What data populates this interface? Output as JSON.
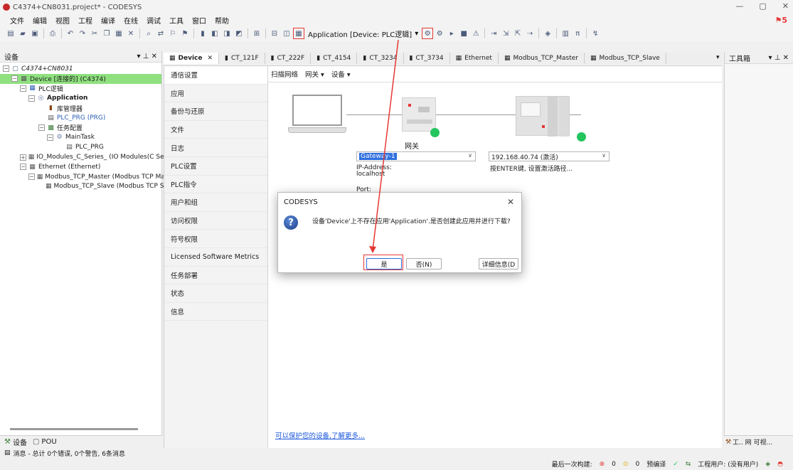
{
  "window": {
    "title": "C4374+CN8031.project* - CODESYS",
    "controls": [
      "—",
      "▢",
      "✕"
    ]
  },
  "menu": [
    "文件",
    "编辑",
    "视图",
    "工程",
    "编译",
    "在线",
    "调试",
    "工具",
    "窗口",
    "帮助"
  ],
  "notifications": {
    "count": "5"
  },
  "toolbar": {
    "active_application": "Application [Device: PLC逻辑]"
  },
  "left_pane": {
    "title": "设备",
    "header_controls": "▾ ⊥ ✕",
    "tree": [
      {
        "label": "C4374+CN8031",
        "italic": true
      },
      {
        "label": "Device [连接的] (C4374)"
      },
      {
        "label": "PLC逻辑"
      },
      {
        "label": "Application"
      },
      {
        "label": "库管理器"
      },
      {
        "label": "PLC_PRG (PRG)"
      },
      {
        "label": "任务配置"
      },
      {
        "label": "MainTask"
      },
      {
        "label": "PLC_PRG"
      },
      {
        "label": "IO_Modules_C_Series_ (IO Modules(C Series"
      },
      {
        "label": "Ethernet (Ethernet)"
      },
      {
        "label": "Modbus_TCP_Master (Modbus TCP Maste"
      },
      {
        "label": "Modbus_TCP_Slave (Modbus TCP Sla"
      }
    ],
    "bottom_tabs": [
      "设备",
      "POU"
    ]
  },
  "editor_tabs": [
    "Device",
    "CT_121F",
    "CT_222F",
    "CT_4154",
    "CT_3234",
    "CT_3734",
    "Ethernet",
    "Modbus_TCP_Master",
    "Modbus_TCP_Slave"
  ],
  "device_editor": {
    "nav": [
      "通信设置",
      "应用",
      "备份与还原",
      "文件",
      "日志",
      "PLC设置",
      "PLC指令",
      "用户和组",
      "访问权限",
      "符号权限",
      "Licensed Software Metrics",
      "任务部署",
      "状态",
      "信息"
    ],
    "subtoolbar": [
      "扫描网络",
      "网关 ▾",
      "设备 ▾"
    ],
    "gateway_label": "网关",
    "gateway_select": "Gateway-1",
    "ip_address_label": "IP-Address:",
    "ip_address_value": "localhost",
    "port_label": "Port:",
    "device_select": "192.168.40.74 (激活)",
    "hint": "按ENTER键, 设置激活路径...",
    "protect_link": "可以保护您的设备,了解更多..."
  },
  "right_pane": {
    "title": "工具箱",
    "header_controls": "▾ ⊥ ✕",
    "bottom_tabs": "工.. 网 可视..."
  },
  "message_bar": "消息 - 总计 0个错误, 0个警告, 6条消息",
  "status_bar": {
    "last_build": "最后一次构建:",
    "errors": "0",
    "warnings": "0",
    "precompile": "预编译",
    "user": "工程用户: (没有用户)"
  },
  "dialog": {
    "title": "CODESYS",
    "message": "设备'Device'上不存在应用'Application'.是否创建此应用并进行下载?",
    "buttons": {
      "yes": "是",
      "no": "否(N)",
      "details": "详细信息(D"
    }
  },
  "colors": {
    "selection_green": "#8fe07f",
    "status_dot": "#22c55e",
    "annotation_red": "#e53935",
    "link_blue": "#1a56db"
  }
}
